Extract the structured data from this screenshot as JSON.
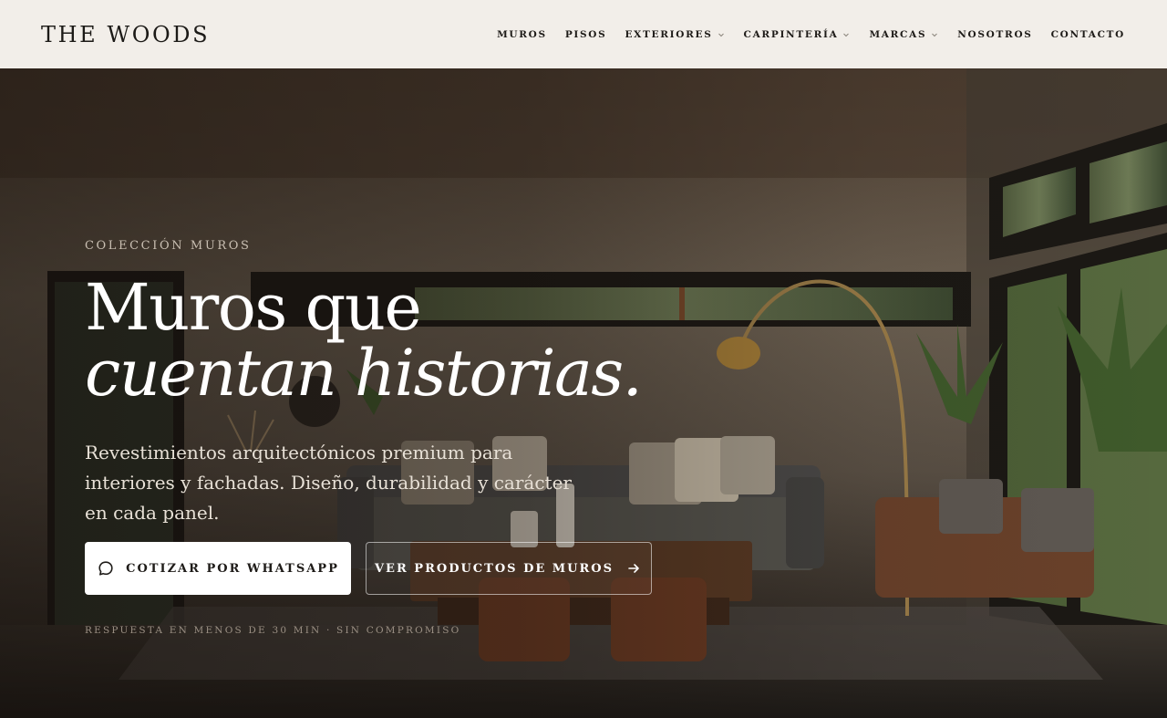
{
  "header": {
    "logo": "THE WOODS",
    "nav": [
      {
        "label": "MUROS",
        "dropdown": false
      },
      {
        "label": "PISOS",
        "dropdown": false
      },
      {
        "label": "EXTERIORES",
        "dropdown": true
      },
      {
        "label": "CARPINTERÍA",
        "dropdown": true
      },
      {
        "label": "MARCAS",
        "dropdown": true
      },
      {
        "label": "NOSOTROS",
        "dropdown": false
      },
      {
        "label": "CONTACTO",
        "dropdown": false
      }
    ]
  },
  "hero": {
    "eyebrow": "COLECCIÓN MUROS",
    "title_line1": "Muros que",
    "title_line2": "cuentan historias.",
    "lead": "Revestimientos arquitectónicos premium para interiores y fachadas. Diseño, durabilidad y carácter en cada panel.",
    "primary_button": {
      "label": "COTIZAR POR WHATSAPP",
      "icon": "chat-bubble-icon"
    },
    "secondary_button": {
      "label": "VER PRODUCTOS DE MUROS",
      "icon": "arrow-right-icon"
    },
    "note": "RESPUESTA EN MENOS DE 30 MIN · SIN COMPROMISO"
  },
  "colors": {
    "header_bg": "#f2eee9",
    "text_dark": "#1e1b18",
    "hero_text": "#ffffff",
    "muted": "#c9bfb2"
  }
}
